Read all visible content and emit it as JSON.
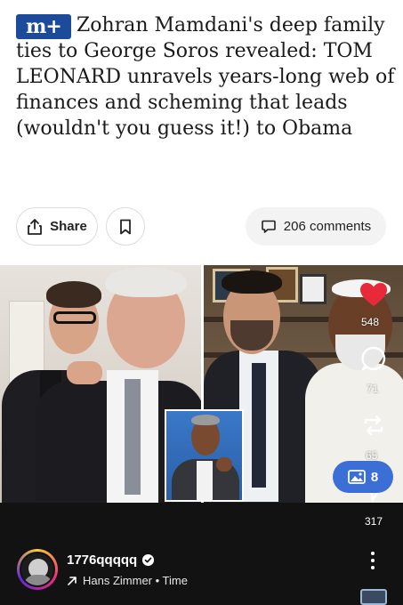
{
  "article": {
    "brand_badge": "m+",
    "headline": "Zohran Mamdani's deep family ties to George Soros revealed: TOM LEONARD unravels years-long web of finances and scheming that leads (wouldn't you guess it!) to Obama",
    "share_label": "Share",
    "comments_label": "206 comments"
  },
  "reactions": {
    "likes": "548",
    "comments": "71",
    "reposts": "65",
    "shares": "317",
    "gallery_count": "8"
  },
  "post": {
    "username": "1776qqqqq",
    "music": "Hans Zimmer • Time"
  },
  "colors": {
    "brand_blue": "#1d4b9b",
    "like_red": "#e8293a",
    "gallery_blue": "#3b6fd6",
    "footer_bg": "#121212"
  },
  "icons": [
    "share-icon",
    "bookmark-icon",
    "comment-bubble-icon",
    "heart-icon",
    "comment-icon",
    "repost-icon",
    "send-icon",
    "gallery-icon",
    "verified-icon",
    "music-arrow-icon",
    "more-icon"
  ]
}
